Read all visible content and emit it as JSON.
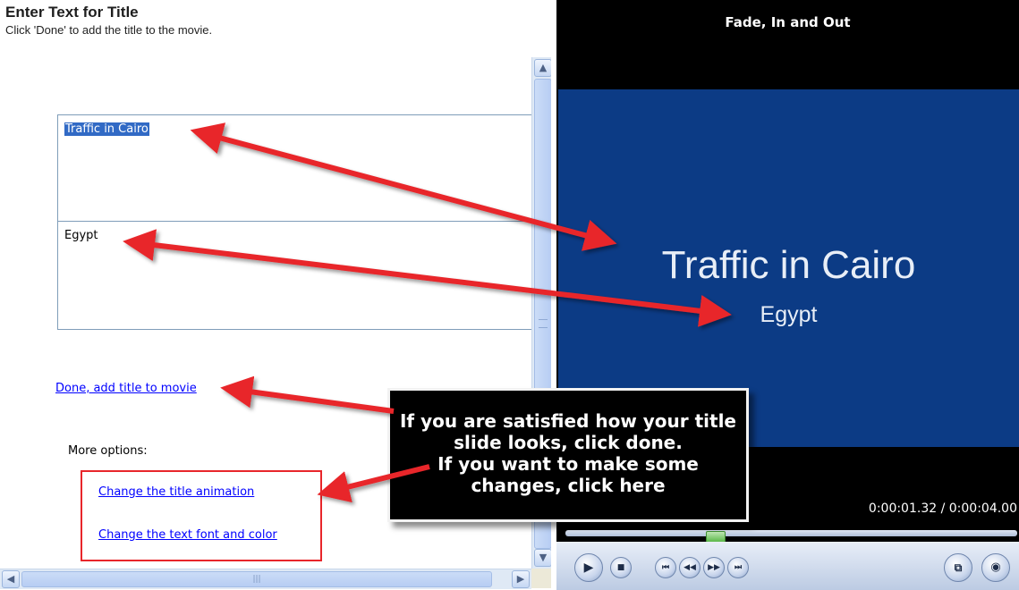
{
  "panel": {
    "heading": "Enter Text for Title",
    "instruction": "Click 'Done' to add the title to the movie.",
    "title_text": "Traffic in Cairo",
    "subtitle_text": "Egypt",
    "done_link": "Done, add title to movie",
    "more_options_label": "More options:",
    "options": [
      {
        "label": "Change the title animation"
      },
      {
        "label": "Change the text font and color"
      }
    ]
  },
  "preview": {
    "clip_title": "Fade, In and Out",
    "video_title": "Traffic in Cairo",
    "video_subtitle": "Egypt",
    "timecode": "0:00:01.32 / 0:00:04.00",
    "seek_progress": 0.33
  },
  "annotation": {
    "lines": [
      "If you are satisfied how your title",
      "slide looks, click done.",
      "If you want to make some",
      "changes, click here"
    ]
  },
  "colors": {
    "link": "#0000ff",
    "selection": "#316ac5",
    "video_bg": "#0c3b85",
    "arrow": "#e8262b"
  },
  "icons": {
    "scroll_up": "chevron-up-icon",
    "scroll_down": "chevron-down-icon",
    "scroll_left": "chevron-left-icon",
    "scroll_right": "chevron-right-icon",
    "play": "play-icon",
    "stop": "stop-icon",
    "previous": "previous-frame-icon",
    "rewind": "rewind-icon",
    "forward": "fast-forward-icon",
    "next": "next-frame-icon",
    "split": "split-clip-icon",
    "snapshot": "camera-icon"
  }
}
